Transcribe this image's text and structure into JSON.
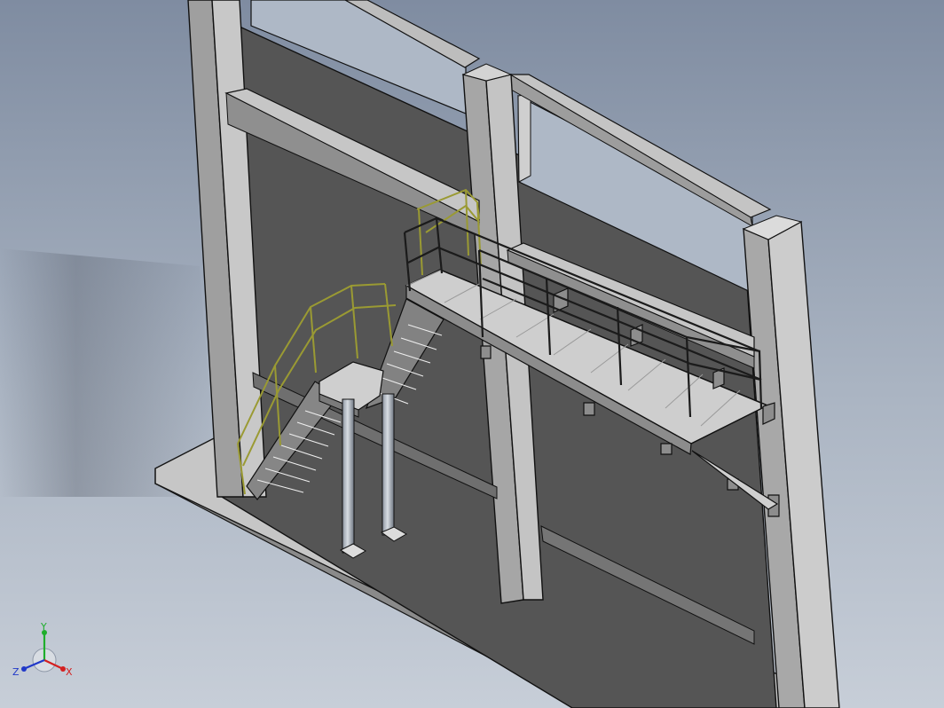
{
  "triad": {
    "x_label": "X",
    "y_label": "Y",
    "z_label": "Z",
    "x_color": "#d42020",
    "y_color": "#1fae2c",
    "z_color": "#2038c8"
  },
  "colors": {
    "background_light": "#b9c1cd",
    "background_dark": "#8e98a8",
    "concrete_front": "#555555",
    "concrete_light": "#c8c8c8",
    "concrete_mid": "#a6a6a6",
    "steel_light": "#d9d9d9",
    "steel_mid": "#9b9b9b",
    "handrail": "#9a9a33",
    "edge": "#111111"
  }
}
